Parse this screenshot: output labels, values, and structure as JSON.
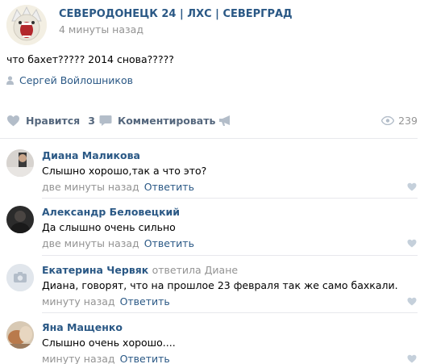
{
  "post": {
    "author_name": "СЕВЕРОДОНЕЦК 24 | ЛХС | СЕВЕРГРАД",
    "time": "4 минуты назад",
    "text": "что бахет????? 2014 снова?????",
    "signer": "Сергей Войлошников"
  },
  "actions": {
    "like_label": "Нравится",
    "like_count": "3",
    "comment_label": "Комментировать",
    "views_count": "239"
  },
  "comments": [
    {
      "author": "Диана Маликова",
      "text": "Слышно хорошо,так а что это?",
      "time": "две минуты назад",
      "reply_label": "Ответить"
    },
    {
      "author": "Александр Беловецкий",
      "text": "Да слышно очень сильно",
      "time": "две минуты назад",
      "reply_label": "Ответить"
    },
    {
      "author": "Екатерина Червяк",
      "reply_note": "ответила",
      "reply_to": "Диане",
      "text": "Диана, говорят, что на прошлое 23 февраля так же само бахкали.",
      "time": "минуту назад",
      "reply_label": "Ответить"
    },
    {
      "author": "Яна Мащенко",
      "text": "Слышно очень хорошо....",
      "time": "минуту назад",
      "reply_label": "Ответить"
    }
  ],
  "icons": {
    "signer": "person-icon",
    "like": "heart-icon",
    "comment": "speech-bubble-icon",
    "share": "megaphone-icon",
    "views": "eye-icon",
    "placeholder_avatar": "camera-icon"
  },
  "colors": {
    "link": "#2a5885",
    "action": "#55677d",
    "muted": "#939393",
    "icon": "#b3bdc9",
    "divider": "#e7e8ec"
  }
}
